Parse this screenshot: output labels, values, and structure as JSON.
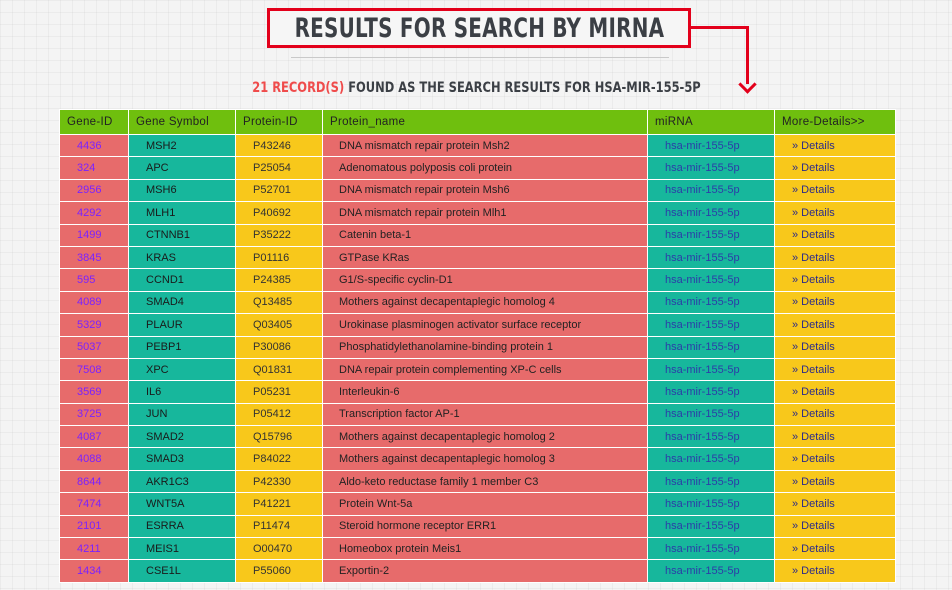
{
  "header": {
    "title": "RESULTS FOR SEARCH BY MIRNA",
    "count": "21 RECORD(S)",
    "summary_text": " FOUND AS THE SEARCH RESULTS FOR HSA-MIR-155-5P"
  },
  "table": {
    "columns": [
      "Gene-ID",
      "Gene Symbol",
      "Protein-ID",
      "Protein_name",
      "miRNA",
      "More-Details>>"
    ],
    "rows": [
      {
        "gene_id": "4436",
        "symbol": "MSH2",
        "protein_id": "P43246",
        "protein_name": "DNA mismatch repair protein Msh2",
        "mirna": "hsa-mir-155-5p",
        "details": "» Details"
      },
      {
        "gene_id": "324",
        "symbol": "APC",
        "protein_id": "P25054",
        "protein_name": "Adenomatous polyposis coli protein",
        "mirna": "hsa-mir-155-5p",
        "details": "» Details"
      },
      {
        "gene_id": "2956",
        "symbol": "MSH6",
        "protein_id": "P52701",
        "protein_name": "DNA mismatch repair protein Msh6",
        "mirna": "hsa-mir-155-5p",
        "details": "» Details"
      },
      {
        "gene_id": "4292",
        "symbol": "MLH1",
        "protein_id": "P40692",
        "protein_name": "DNA mismatch repair protein Mlh1",
        "mirna": "hsa-mir-155-5p",
        "details": "» Details"
      },
      {
        "gene_id": "1499",
        "symbol": "CTNNB1",
        "protein_id": "P35222",
        "protein_name": "Catenin beta-1",
        "mirna": "hsa-mir-155-5p",
        "details": "» Details"
      },
      {
        "gene_id": "3845",
        "symbol": "KRAS",
        "protein_id": "P01116",
        "protein_name": "GTPase KRas",
        "mirna": "hsa-mir-155-5p",
        "details": "» Details"
      },
      {
        "gene_id": "595",
        "symbol": "CCND1",
        "protein_id": "P24385",
        "protein_name": "G1/S-specific cyclin-D1",
        "mirna": "hsa-mir-155-5p",
        "details": "» Details"
      },
      {
        "gene_id": "4089",
        "symbol": "SMAD4",
        "protein_id": "Q13485",
        "protein_name": "Mothers against decapentaplegic homolog 4",
        "mirna": "hsa-mir-155-5p",
        "details": "» Details"
      },
      {
        "gene_id": "5329",
        "symbol": "PLAUR",
        "protein_id": "Q03405",
        "protein_name": "Urokinase plasminogen activator surface receptor",
        "mirna": "hsa-mir-155-5p",
        "details": "» Details"
      },
      {
        "gene_id": "5037",
        "symbol": "PEBP1",
        "protein_id": "P30086",
        "protein_name": "Phosphatidylethanolamine-binding protein 1",
        "mirna": "hsa-mir-155-5p",
        "details": "» Details"
      },
      {
        "gene_id": "7508",
        "symbol": "XPC",
        "protein_id": "Q01831",
        "protein_name": "DNA repair protein complementing XP-C cells",
        "mirna": "hsa-mir-155-5p",
        "details": "» Details"
      },
      {
        "gene_id": "3569",
        "symbol": "IL6",
        "protein_id": "P05231",
        "protein_name": "Interleukin-6",
        "mirna": "hsa-mir-155-5p",
        "details": "» Details"
      },
      {
        "gene_id": "3725",
        "symbol": "JUN",
        "protein_id": "P05412",
        "protein_name": "Transcription factor AP-1",
        "mirna": "hsa-mir-155-5p",
        "details": "» Details"
      },
      {
        "gene_id": "4087",
        "symbol": "SMAD2",
        "protein_id": "Q15796",
        "protein_name": "Mothers against decapentaplegic homolog 2",
        "mirna": "hsa-mir-155-5p",
        "details": "» Details"
      },
      {
        "gene_id": "4088",
        "symbol": "SMAD3",
        "protein_id": "P84022",
        "protein_name": "Mothers against decapentaplegic homolog 3",
        "mirna": "hsa-mir-155-5p",
        "details": "» Details"
      },
      {
        "gene_id": "8644",
        "symbol": "AKR1C3",
        "protein_id": "P42330",
        "protein_name": "Aldo-keto reductase family 1 member C3",
        "mirna": "hsa-mir-155-5p",
        "details": "» Details"
      },
      {
        "gene_id": "7474",
        "symbol": "WNT5A",
        "protein_id": "P41221",
        "protein_name": "Protein Wnt-5a",
        "mirna": "hsa-mir-155-5p",
        "details": "» Details"
      },
      {
        "gene_id": "2101",
        "symbol": "ESRRA",
        "protein_id": "P11474",
        "protein_name": "Steroid hormone receptor ERR1",
        "mirna": "hsa-mir-155-5p",
        "details": "» Details"
      },
      {
        "gene_id": "4211",
        "symbol": "MEIS1",
        "protein_id": "O00470",
        "protein_name": "Homeobox protein Meis1",
        "mirna": "hsa-mir-155-5p",
        "details": "» Details"
      },
      {
        "gene_id": "1434",
        "symbol": "CSE1L",
        "protein_id": "P55060",
        "protein_name": "Exportin-2",
        "mirna": "hsa-mir-155-5p",
        "details": "» Details"
      }
    ]
  },
  "colors": {
    "header_green": "#6fbf0e",
    "cell_red": "#e76b6b",
    "cell_teal": "#17b79c",
    "cell_yellow": "#f8c81b",
    "annotation_red": "#e3001b",
    "count_red": "#ef4b4b"
  }
}
